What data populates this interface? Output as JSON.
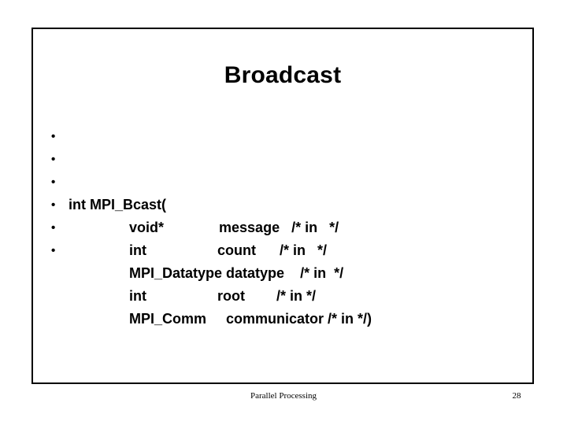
{
  "colors": {
    "background": "#ffffff",
    "text": "#000000",
    "border": "#000000"
  },
  "slide": {
    "title": "Broadcast",
    "bullet_glyph": "•",
    "body": [
      {
        "indent": 0,
        "text": "int MPI_Bcast("
      },
      {
        "indent": 1,
        "text": "void*              message   /* in   */"
      },
      {
        "indent": 1,
        "text": "int                  count      /* in   */"
      },
      {
        "indent": 1,
        "text": "MPI_Datatype datatype    /* in  */"
      },
      {
        "indent": 1,
        "text": "int                  root        /* in */"
      },
      {
        "indent": 1,
        "text": "MPI_Comm     communicator /* in */)"
      }
    ]
  },
  "footer": {
    "note": "Parallel Processing",
    "page_number": "28"
  }
}
